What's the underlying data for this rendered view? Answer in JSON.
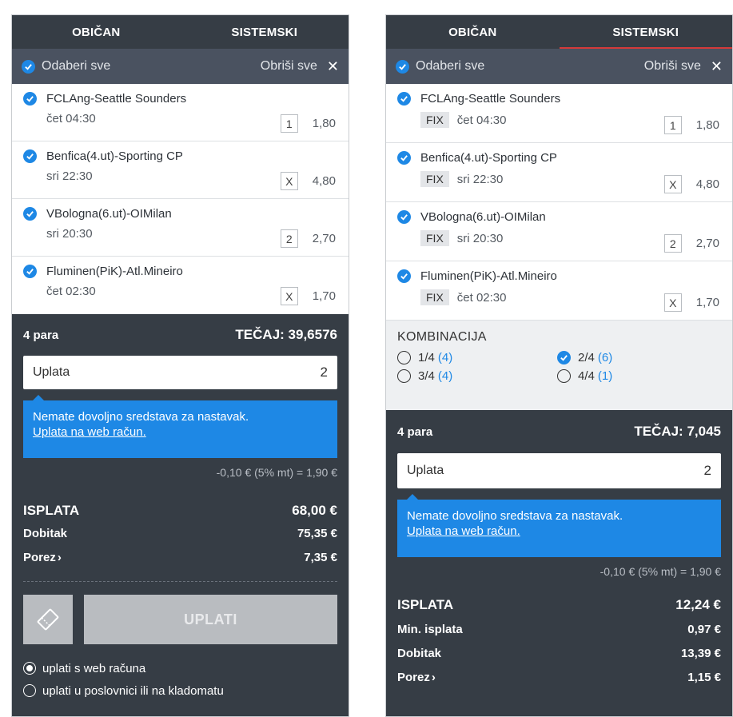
{
  "left": {
    "tabs": [
      "OBIČAN",
      "SISTEMSKI"
    ],
    "select_all": "Odaberi sve",
    "clear_all": "Obriši sve",
    "matches": [
      {
        "title": "FCLAng-Seattle Sounders",
        "time": "čet 04:30",
        "pick": "1",
        "odds": "1,80"
      },
      {
        "title": "Benfica(4.ut)-Sporting CP",
        "time": "sri 22:30",
        "pick": "X",
        "odds": "4,80"
      },
      {
        "title": "VBologna(6.ut)-OIMilan",
        "time": "sri 20:30",
        "pick": "2",
        "odds": "2,70"
      },
      {
        "title": "Fluminen(PiK)-Atl.Mineiro",
        "time": "čet 02:30",
        "pick": "X",
        "odds": "1,70"
      }
    ],
    "pairs": "4 para",
    "total_odds": "TEČAJ: 39,6576",
    "stake_label": "Uplata",
    "stake_value": "2",
    "alert_text": "Nemate dovoljno sredstava za nastavak.",
    "alert_link": "Uplata na web račun.",
    "fee": "-0,10 € (5% mt) = 1,90 €",
    "payout_label": "ISPLATA",
    "payout_value": "68,00 €",
    "win_label": "Dobitak",
    "win_value": "75,35 €",
    "tax_label": "Porez",
    "tax_value": "7,35 €",
    "submit": "UPLATI",
    "pay_options": [
      "uplati s web računa",
      "uplati u poslovnici ili na kladomatu"
    ]
  },
  "right": {
    "tabs": [
      "OBIČAN",
      "SISTEMSKI"
    ],
    "select_all": "Odaberi sve",
    "clear_all": "Obriši sve",
    "fix_label": "FIX",
    "matches": [
      {
        "title": "FCLAng-Seattle Sounders",
        "time": "čet 04:30",
        "pick": "1",
        "odds": "1,80"
      },
      {
        "title": "Benfica(4.ut)-Sporting CP",
        "time": "sri 22:30",
        "pick": "X",
        "odds": "4,80"
      },
      {
        "title": "VBologna(6.ut)-OIMilan",
        "time": "sri 20:30",
        "pick": "2",
        "odds": "2,70"
      },
      {
        "title": "Fluminen(PiK)-Atl.Mineiro",
        "time": "čet 02:30",
        "pick": "X",
        "odds": "1,70"
      }
    ],
    "combination_title": "KOMBINACIJA",
    "combinations": [
      {
        "label": "1/4",
        "count": "(4)",
        "checked": false
      },
      {
        "label": "2/4",
        "count": "(6)",
        "checked": true
      },
      {
        "label": "3/4",
        "count": "(4)",
        "checked": false
      },
      {
        "label": "4/4",
        "count": "(1)",
        "checked": false
      }
    ],
    "pairs": "4 para",
    "total_odds": "TEČAJ: 7,045",
    "stake_label": "Uplata",
    "stake_value": "2",
    "alert_text": "Nemate dovoljno sredstava za nastavak.",
    "alert_link": "Uplata na web račun.",
    "fee": "-0,10 € (5% mt) = 1,90 €",
    "payout_label": "ISPLATA",
    "payout_value": "12,24 €",
    "min_payout_label": "Min. isplata",
    "min_payout_value": "0,97 €",
    "win_label": "Dobitak",
    "win_value": "13,39 €",
    "tax_label": "Porez",
    "tax_value": "1,15 €"
  },
  "colors": {
    "accent": "#1e88e5",
    "panel_dark": "#363d45",
    "tab_underline": "#d43a3a"
  }
}
